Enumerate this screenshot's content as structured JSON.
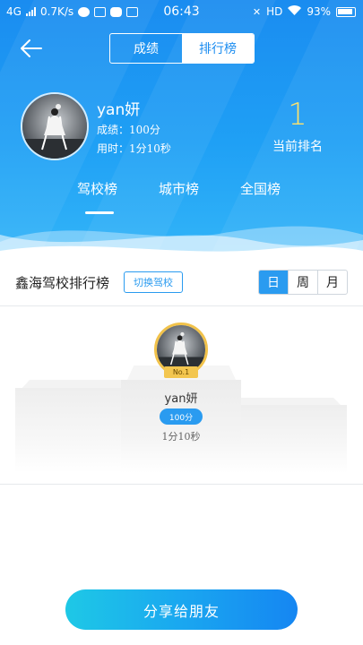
{
  "status_bar": {
    "network": "4G",
    "speed": "0.7K/s",
    "time": "06:43",
    "hd": "HD",
    "battery": "93%"
  },
  "header": {
    "tabs": [
      {
        "label": "成绩",
        "selected": false
      },
      {
        "label": "排行榜",
        "selected": true
      }
    ]
  },
  "profile": {
    "name": "yan妍",
    "score_line": "成绩：100分",
    "time_line": "用时：1分10秒",
    "rank": "1",
    "rank_label": "当前排名"
  },
  "category_tabs": [
    {
      "label": "驾校榜",
      "selected": true
    },
    {
      "label": "城市榜",
      "selected": false
    },
    {
      "label": "全国榜",
      "selected": false
    }
  ],
  "leaderboard": {
    "title": "鑫海驾校排行榜",
    "switch_label": "切换驾校",
    "periods": [
      {
        "label": "日",
        "selected": true
      },
      {
        "label": "周",
        "selected": false
      },
      {
        "label": "月",
        "selected": false
      }
    ],
    "winner": {
      "badge": "No.1",
      "name": "yan妍",
      "score": "100分",
      "time": "1分10秒"
    }
  },
  "share_button": "分享给朋友",
  "colors": {
    "primary_blue": "#1a8cf0",
    "accent_blue": "#2a9bf0",
    "rank_yellow": "#ffe26b",
    "gold": "#f3c64f"
  }
}
